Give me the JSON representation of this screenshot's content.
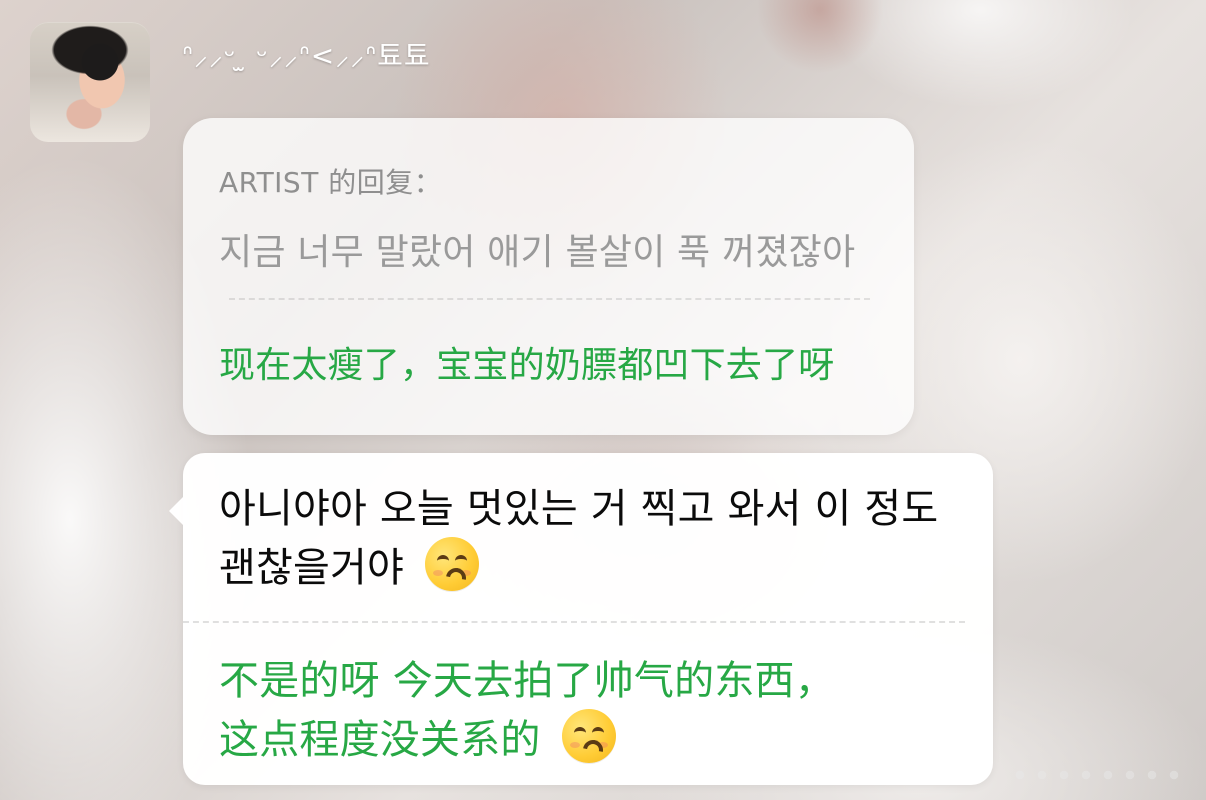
{
  "header": {
    "username": "ᐢ⸝⸝ᵕ ̫ ᵕ⸝⸝ᐢ<⸝⸝ᐢ툐툐"
  },
  "reply": {
    "label": "ARTIST 的回复：",
    "original_text": "지금 너무 말랐어 애기 볼살이 푹 꺼졌잖아",
    "translation_text": "现在太瘦了，宝宝的奶膘都凹下去了呀"
  },
  "message": {
    "original_text": "아니야아 오늘 멋있는 거 찍고 와서 이 정도 괜찮을거야",
    "translation_text": "不是的呀 今天去拍了帅气的东西，这点程度没关系的",
    "emoji_icon": "kissing-face-with-closed-eyes-icon"
  },
  "colors": {
    "translation_green": "#27a845",
    "reply_gray": "#9a9a9a",
    "message_text": "#0b0b0b"
  }
}
